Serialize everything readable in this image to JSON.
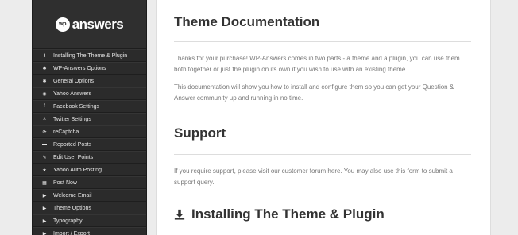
{
  "logo": {
    "badge": "wp",
    "text": "answers"
  },
  "sidebar": {
    "items": [
      {
        "label": "Installing The Theme & Plugin",
        "icon": "download-icon",
        "glyph": "⬇"
      },
      {
        "label": "WP-Answers Options",
        "icon": "gear-icon",
        "glyph": "✱"
      },
      {
        "label": "General Options",
        "icon": "cog-icon",
        "glyph": "✱"
      },
      {
        "label": "Yahoo Answers",
        "icon": "circle-icon",
        "glyph": "◉"
      },
      {
        "label": "Facebook Settings",
        "icon": "facebook-icon",
        "glyph": "f"
      },
      {
        "label": "Twitter Settings",
        "icon": "twitter-icon",
        "glyph": "ᴧ"
      },
      {
        "label": "reCaptcha",
        "icon": "refresh-icon",
        "glyph": "⟳"
      },
      {
        "label": "Reported Posts",
        "icon": "flag-icon",
        "glyph": "▬"
      },
      {
        "label": "Edit User Points",
        "icon": "edit-icon",
        "glyph": "✎"
      },
      {
        "label": "Yahoo Auto Posting",
        "icon": "star-icon",
        "glyph": "★"
      },
      {
        "label": "Post Now",
        "icon": "calendar-icon",
        "glyph": "▦"
      },
      {
        "label": "Welcome Email",
        "icon": "play-icon",
        "glyph": "▶"
      },
      {
        "label": "Theme Options",
        "icon": "play-icon",
        "glyph": "▶"
      },
      {
        "label": "Typography",
        "icon": "play-icon",
        "glyph": "▶"
      },
      {
        "label": "Import / Export",
        "icon": "play-icon",
        "glyph": "▶"
      }
    ]
  },
  "main": {
    "title": "Theme Documentation",
    "intro_p1": "Thanks for your purchase! WP-Answers comes in two parts - a theme and a plugin, you can use them both together or just the plugin on its own if you wish to use with an existing theme.",
    "intro_p2": "This documentation will show you how to install and configure them so you can get your Question & Answer community up and running in no time.",
    "support_heading": "Support",
    "support_text": "If you require support, please visit our customer forum here. You may also use this form to submit a support query.",
    "install_heading": "Installing The Theme & Plugin"
  },
  "colors": {
    "sidebar_bg": "#2b2b2b",
    "content_bg": "#ffffff",
    "heading": "#333333",
    "body_text": "#777777"
  }
}
